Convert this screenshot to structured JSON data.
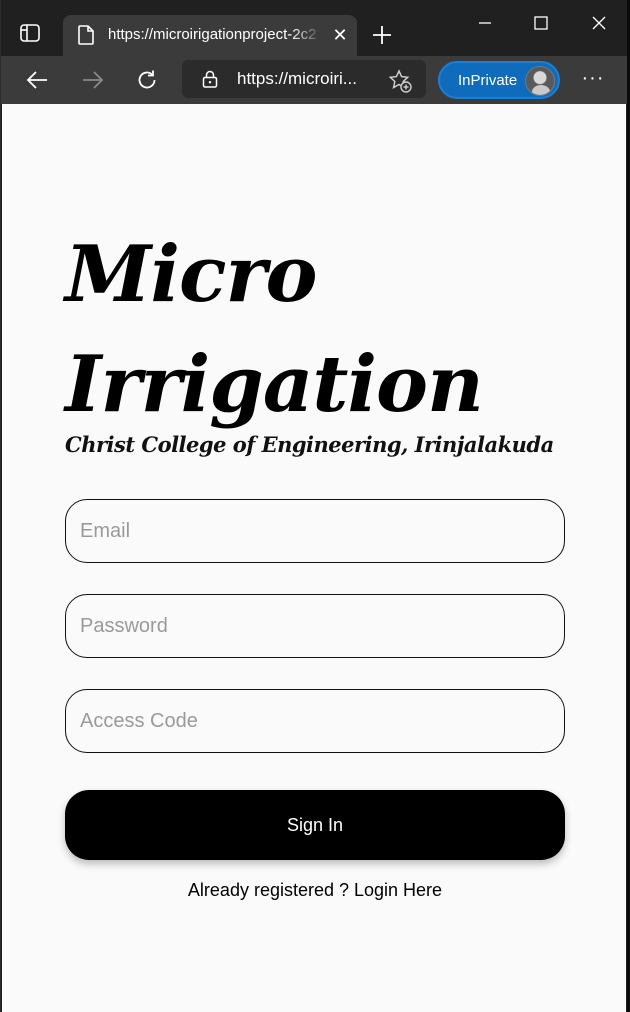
{
  "browser": {
    "tab": {
      "title": "https://microirigationproject-2c2",
      "close_glyph": "✕",
      "icon": "page-icon"
    },
    "new_tab_icon": "plus-icon",
    "window_controls": [
      "minimize-icon",
      "maximize-icon",
      "close-icon"
    ],
    "nav": {
      "back_icon": "back-arrow-icon",
      "forward_icon": "forward-arrow-icon",
      "refresh_icon": "refresh-icon"
    },
    "address": {
      "url": "https://microiri...",
      "lock_icon": "lock-icon",
      "favorites_icon": "add-favorite-icon"
    },
    "inprivate_label": "InPrivate",
    "more_glyph": "···",
    "colors": {
      "tabbar_bg": "#202020",
      "navbar_bg": "#3b3b3b",
      "inprivate_accent": "#0f6cbd"
    }
  },
  "page": {
    "title_line1": "Micro",
    "title_line2": "Irrigation",
    "subtitle": "Christ College of Engineering, Irinjalakuda",
    "email_placeholder": "Email",
    "password_placeholder": "Password",
    "access_code_placeholder": "Access Code",
    "signin_label": "Sign In",
    "login_link": "Already registered ? Login Here",
    "colors": {
      "background": "#fafafa",
      "button_bg": "#000000",
      "button_text": "#ffffff"
    }
  }
}
